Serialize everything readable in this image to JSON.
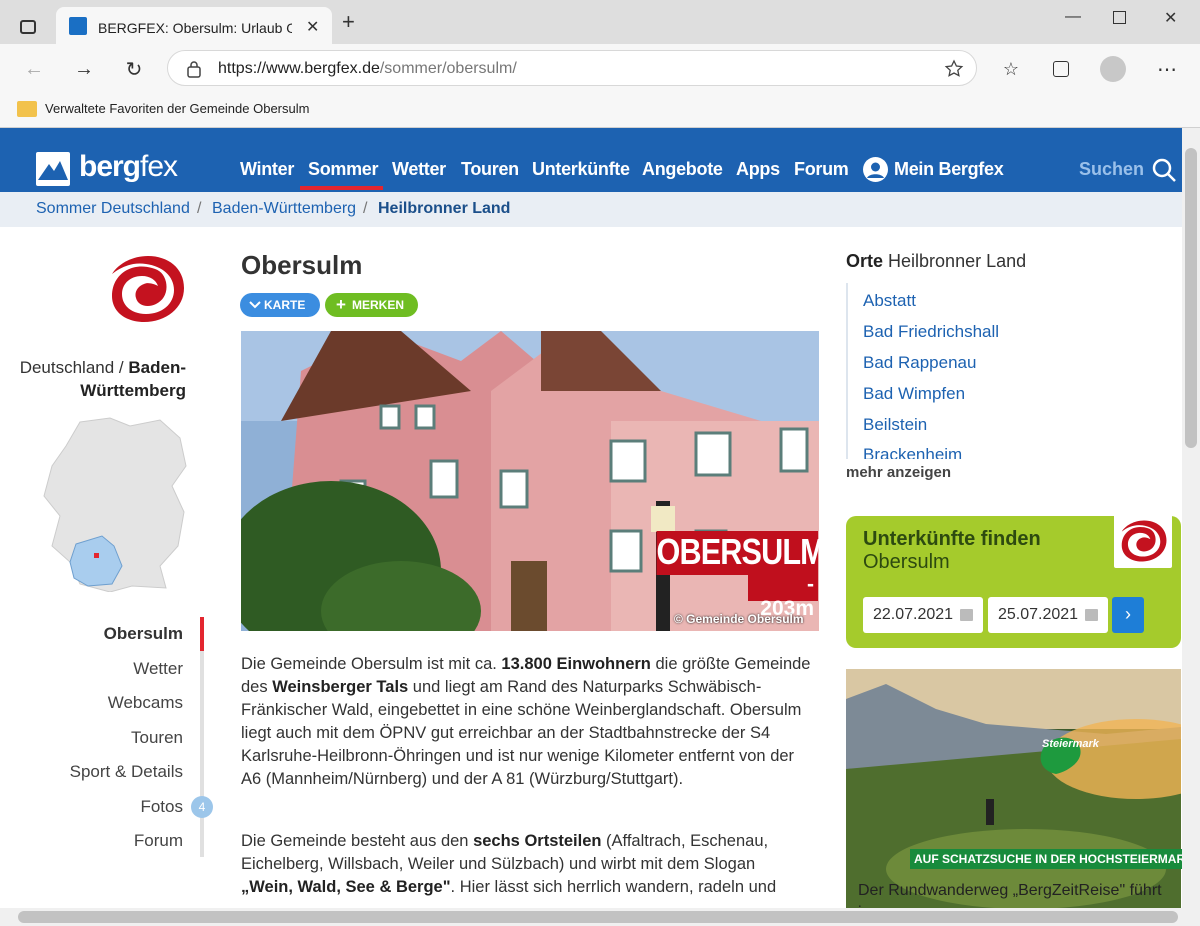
{
  "browser": {
    "tab_title": "BERGFEX: Obersulm: Urlaub Obe",
    "url_host": "https://www.bergfex.de",
    "url_path": "/sommer/obersulm/",
    "favorites_label": "Verwaltete Favoriten der Gemeinde Obersulm"
  },
  "site": {
    "logo_text_a": "berg",
    "logo_text_b": "fex",
    "nav": [
      "Winter",
      "Sommer",
      "Wetter",
      "Touren",
      "Unterkünfte",
      "Angebote",
      "Apps",
      "Forum"
    ],
    "my_label": "Mein Bergfex",
    "search_label": "Suchen",
    "accent_color": "#1d62b1",
    "active_color": "#e3262f"
  },
  "breadcrumb": [
    "Sommer Deutschland",
    "Baden-Württemberg",
    "Heilbronner Land"
  ],
  "left": {
    "country": "Deutschland",
    "state_a": "Baden-",
    "state_b": "Württemberg",
    "subnav": [
      "Obersulm",
      "Wetter",
      "Webcams",
      "Touren",
      "Sport & Details",
      "Fotos",
      "Forum"
    ],
    "fotos_count": "4"
  },
  "main": {
    "title": "Obersulm",
    "karte_label": "KARTE",
    "merken_label": "MERKEN",
    "photo_place": "OBERSULM",
    "photo_alt": "- 203m",
    "photo_credit": "© Gemeinde Obersulm",
    "para1": [
      {
        "t": "Die Gemeinde Obersulm ist mit ca. "
      },
      {
        "b": "13.800 Einwohnern"
      },
      {
        "t": " die größte Gemeinde des "
      },
      {
        "b": "Weinsberger Tals"
      },
      {
        "t": " und liegt am Rand des Naturparks Schwäbisch-Fränkischer Wald, eingebettet in eine schöne Weinberglandschaft. Obersulm liegt auch mit dem ÖPNV gut erreichbar an der Stadtbahnstrecke der S4 Karlsruhe-Heilbronn-Öhringen und ist nur wenige Kilometer entfernt von der A6 (Mannheim/Nürnberg) und der A 81 (Würzburg/Stuttgart)."
      }
    ],
    "para2": [
      {
        "t": "Die Gemeinde besteht aus den "
      },
      {
        "b": "sechs Ortsteilen"
      },
      {
        "t": " (Affaltrach, Eschenau, Eichelberg, Willsbach, Weiler und Sülzbach) und wirbt mit dem Slogan "
      },
      {
        "b": "„Wein, Wald, See & Berge\""
      },
      {
        "t": ". Hier lässt sich herrlich wandern, radeln und"
      }
    ]
  },
  "right": {
    "orte_bold": "Orte",
    "orte_region": "Heilbronner Land",
    "orte": [
      "Abstatt",
      "Bad Friedrichshall",
      "Bad Rappenau",
      "Bad Wimpfen",
      "Beilstein",
      "Brackenheim"
    ],
    "mehr": "mehr anzeigen",
    "unter_title": "Unterkünfte finden",
    "unter_place": "Obersulm",
    "date_from": "22.07.2021",
    "date_to": "25.07.2021",
    "ad_band": "AUF SCHATZSUCHE IN DER HOCHSTEIERMARK",
    "ad_logo": "Steiermark",
    "ad_text": "Der Rundwanderweg „BergZeitReise\" führt in"
  }
}
